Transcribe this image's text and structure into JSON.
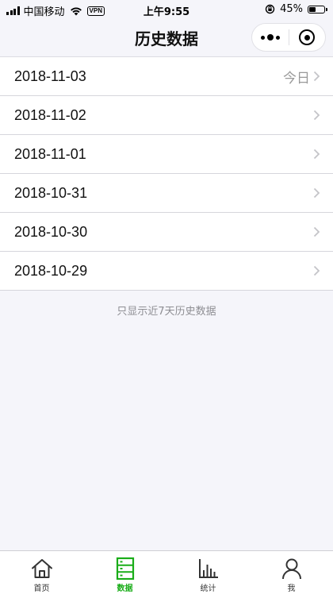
{
  "status_bar": {
    "carrier": "中国移动",
    "vpn": "VPN",
    "time": "上午9:55",
    "battery_text": "45%",
    "battery_level": 0.45
  },
  "nav": {
    "title": "历史数据"
  },
  "history": {
    "items": [
      {
        "date": "2018-11-03",
        "tag": "今日"
      },
      {
        "date": "2018-11-02",
        "tag": ""
      },
      {
        "date": "2018-11-01",
        "tag": ""
      },
      {
        "date": "2018-10-31",
        "tag": ""
      },
      {
        "date": "2018-10-30",
        "tag": ""
      },
      {
        "date": "2018-10-29",
        "tag": ""
      }
    ],
    "note": "只显示近7天历史数据"
  },
  "tabbar": {
    "tabs": [
      {
        "label": "首页",
        "icon": "home-icon",
        "active": false
      },
      {
        "label": "数据",
        "icon": "data-server-icon",
        "active": true
      },
      {
        "label": "统计",
        "icon": "bar-chart-icon",
        "active": false
      },
      {
        "label": "我",
        "icon": "user-icon",
        "active": false
      }
    ],
    "active_color": "#1aad19"
  }
}
